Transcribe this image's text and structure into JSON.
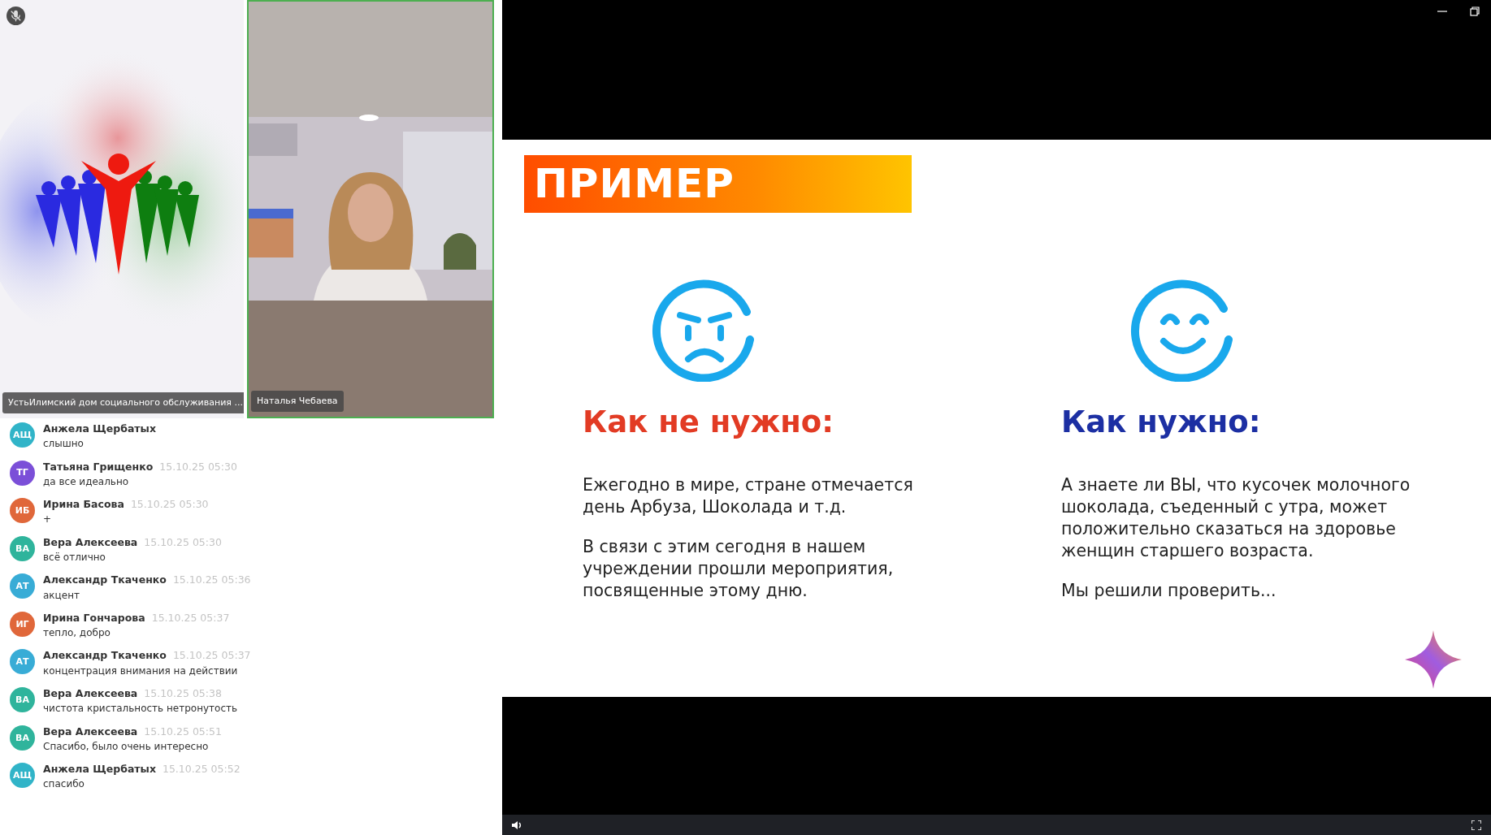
{
  "participants": [
    {
      "kind": "logo",
      "name": "УстьИлимский дом социального обслуживания ...",
      "muted": true,
      "speaking": false
    },
    {
      "kind": "camera",
      "name": "Наталья Чебаева",
      "muted": false,
      "speaking": true
    }
  ],
  "chat": [
    {
      "initials": "АЩ",
      "name": "Анжела Щербатых",
      "text": "слышно",
      "color": "#31b4c8"
    },
    {
      "initials": "ТГ",
      "name": "Татьяна Грищенко",
      "time": "15.10.25 05:30",
      "text": "да все идеально",
      "color": "#7b4fd8"
    },
    {
      "initials": "ИБ",
      "name": "Ирина Басова",
      "time": "15.10.25 05:30",
      "text": "+",
      "color": "#e0673a"
    },
    {
      "initials": "ВА",
      "name": "Вера Алексеева",
      "time": "15.10.25 05:30",
      "text": "всё отлично",
      "color": "#2fb49c"
    },
    {
      "initials": "АТ",
      "name": "Александр Ткаченко",
      "time": "15.10.25 05:36",
      "text": "акцент",
      "color": "#38acd6"
    },
    {
      "initials": "ИГ",
      "name": "Ирина Гончарова",
      "time": "15.10.25 05:37",
      "text": "тепло, добро",
      "color": "#e0673a"
    },
    {
      "initials": "АТ",
      "name": "Александр Ткаченко",
      "time": "15.10.25 05:37",
      "text": "концентрация внимания на действии",
      "color": "#38acd6"
    },
    {
      "initials": "ВА",
      "name": "Вера Алексеева",
      "time": "15.10.25 05:38",
      "text": "чистота кристальность нетронутость",
      "color": "#2fb49c"
    },
    {
      "initials": "ВА",
      "name": "Вера Алексеева",
      "time": "15.10.25 05:51",
      "text": "Спасибо, было очень интересно",
      "color": "#2fb49c"
    },
    {
      "initials": "АЩ",
      "name": "Анжела Щербатых",
      "time": "15.10.25 05:52",
      "text": "спасибо",
      "color": "#31b4c8"
    }
  ],
  "slide": {
    "banner": "ПРИМЕР",
    "columns": [
      {
        "kind": "sad",
        "heading": "Как не нужно:",
        "paragraphs": [
          "Ежегодно в мире, стране отмечается день Арбуза, Шоколада и т.д.",
          "В связи с этим сегодня в нашем учреждении прошли мероприятия, посвященные этому дню."
        ]
      },
      {
        "kind": "happy",
        "heading": "Как нужно:",
        "paragraphs": [
          "А знаете ли ВЫ, что кусочек молочного шоколада, съеденный с утра, может положительно сказаться на здоровье женщин старшего возраста.",
          "Мы решили проверить..."
        ]
      }
    ]
  }
}
